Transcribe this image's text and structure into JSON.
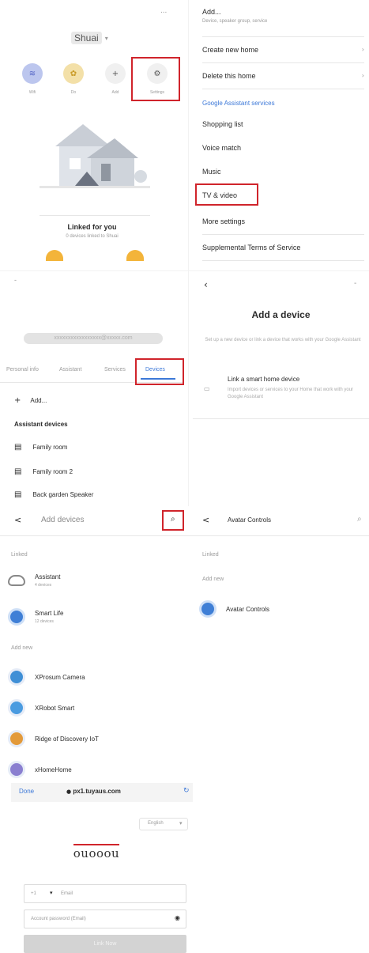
{
  "home": {
    "menu": "...",
    "home_name": "Shuai",
    "shortcuts": [
      {
        "label": "Wifi",
        "icon": "wifi-icon",
        "glyph": "≋",
        "color": "#bcc6ee",
        "fg": "#5565c6"
      },
      {
        "label": "Do",
        "icon": "bulb-icon",
        "glyph": "✿",
        "color": "#f3e0a8",
        "fg": "#c99a25"
      },
      {
        "label": "Add",
        "icon": "plus-icon",
        "glyph": "+",
        "color": "#f0f0f0",
        "fg": "#555555"
      },
      {
        "label": "Settings",
        "icon": "gear-icon",
        "glyph": "⚙",
        "color": "#f0f0f0",
        "fg": "#555555"
      }
    ],
    "linked_title": "Linked for you",
    "linked_sub": "0 devices linked to Shuai"
  },
  "settings_menu": {
    "items": [
      {
        "label": "Add...",
        "sub": "Device, speaker group, service",
        "chevron": false
      },
      {
        "label": "Create new home",
        "sub": "",
        "chevron": true
      },
      {
        "label": "Delete this home",
        "sub": "",
        "chevron": true
      }
    ],
    "section": "Google Assistant services",
    "services": [
      "Shopping list",
      "Voice match",
      "Music",
      "TV & video",
      "More settings",
      "Supplemental Terms of Service"
    ]
  },
  "account": {
    "email": "xxxxxxxxxxxxxxxxx@xxxxx.com",
    "tabs": [
      "Personal info",
      "Assistant",
      "Services",
      "Devices"
    ],
    "add_label": "Add...",
    "section": "Assistant devices",
    "devices": [
      "Family room",
      "Family room 2",
      "Back garden Speaker"
    ]
  },
  "add_device": {
    "title": "Add a device",
    "description": "Set up a new device or link a device that works with your Google Assistant",
    "option_title": "Link a smart home device",
    "option_sub": "Import devices or services to your Home that work with your Google Assistant",
    "option_icon": "link-icon"
  },
  "add_devices": {
    "back": "<",
    "title": "Add devices",
    "linked_header": "Linked",
    "linked": [
      {
        "name": "Assistant",
        "sub": "4 devices",
        "icon": "cloud-icon",
        "color": "#ffffff"
      },
      {
        "name": "Smart Life",
        "sub": "12 devices",
        "icon": "smart-life-icon",
        "color": "#3f7fd6"
      }
    ],
    "new_header": "Add new",
    "new": [
      {
        "name": "XProsum Camera",
        "icon": "camera-logo-icon",
        "color": "#3f8fd6"
      },
      {
        "name": "XRobot Smart",
        "icon": "robot-logo-icon",
        "color": "#4a9be0"
      },
      {
        "name": "Ridge of Discovery IoT",
        "icon": "ridge-logo-icon",
        "color": "#e39a3a"
      },
      {
        "name": "xHomeHome",
        "icon": "home-logo-icon",
        "color": "#8a7fd0"
      }
    ]
  },
  "search_result": {
    "back": "<",
    "title": "Avatar Controls",
    "linked_header": "Linked",
    "new_header": "Add new",
    "result": {
      "name": "Avatar Controls",
      "icon": "avatar-logo-icon",
      "color": "#3f7fd6"
    }
  },
  "login": {
    "done": "Done",
    "url": "px1.tuyaus.com",
    "lang": "English",
    "logo": "ouooou",
    "country_code": "+1",
    "phone_placeholder": "Email",
    "password_placeholder": "Account password (Email)",
    "button": "Link Now"
  }
}
